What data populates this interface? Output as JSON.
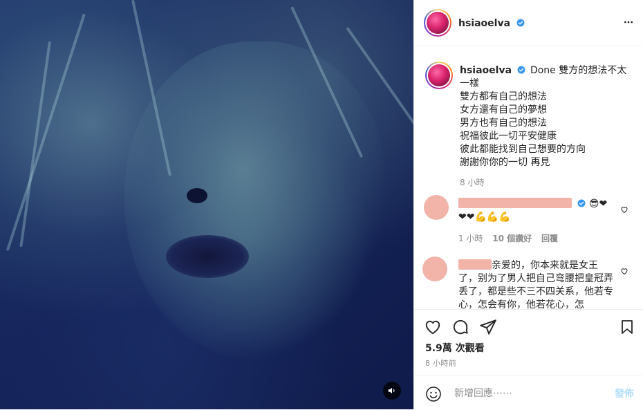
{
  "post": {
    "username": "hsiaoelva",
    "mute_icon": "speaker-muted-icon"
  },
  "caption": {
    "username": "hsiaoelva",
    "lines": [
      "Done 雙方的想法不太一樣",
      "雙方都有自己的想法",
      "女方還有自己的夢想",
      "男方也有自己的想法",
      "祝福彼此一切平安健康",
      "彼此都能找到自己想要的方向",
      "謝謝你你的一切 再見"
    ],
    "time": "8 小時"
  },
  "comments": [
    {
      "emoji_line": "😎❤",
      "second_line": "❤❤💪💪💪",
      "time": "1 小時",
      "likes": "10 個讚好",
      "reply": "回覆"
    },
    {
      "text": "亲爱的，你本来就是女王了，别为了男人把自己弯腰把皇冠弄丢了，都是些不三不四关系，他若专心，怎会有你，他若花心，怎"
    }
  ],
  "stats": {
    "views": "5.9萬 次觀看",
    "posted": "8 小時前"
  },
  "composer": {
    "placeholder": "新增回應⋯⋯",
    "post_label": "發佈"
  },
  "colors": {
    "verified": "#3897f0",
    "post_button_disabled": "#b2dffc",
    "redacted": "#f2b3a8"
  }
}
